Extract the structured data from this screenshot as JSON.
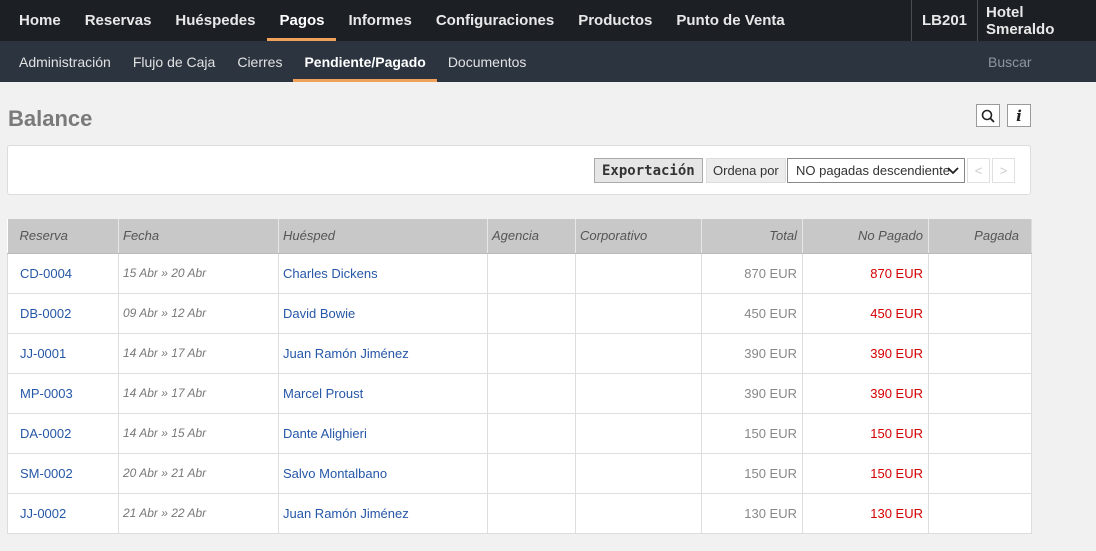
{
  "topnav": {
    "items": [
      "Home",
      "Reservas",
      "Huéspedes",
      "Pagos",
      "Informes",
      "Configuraciones",
      "Productos",
      "Punto de Venta"
    ],
    "active_index": 3,
    "code": "LB201",
    "hotel": "Hotel Smeraldo"
  },
  "subnav": {
    "items": [
      "Administración",
      "Flujo de Caja",
      "Cierres",
      "Pendiente/Pagado",
      "Documentos"
    ],
    "active_index": 3,
    "search": "Buscar"
  },
  "page": {
    "title": "Balance",
    "info_label": "i"
  },
  "toolbar": {
    "export_label": "Exportación",
    "sort_label": "Ordena por",
    "sort_value": "NO pagadas descendiente",
    "prev": "<",
    "next": ">"
  },
  "table": {
    "columns": [
      "Reserva",
      "Fecha",
      "Huésped",
      "Agencia",
      "Corporativo",
      "Total",
      "No Pagado",
      "Pagada"
    ],
    "rows": [
      {
        "reserva": "CD-0004",
        "fecha": "15 Abr » 20 Abr",
        "huesped": "Charles Dickens",
        "agencia": "",
        "corporativo": "",
        "total": "870 EUR",
        "no_pagado": "870 EUR",
        "pagada": ""
      },
      {
        "reserva": "DB-0002",
        "fecha": "09 Abr » 12 Abr",
        "huesped": "David Bowie",
        "agencia": "",
        "corporativo": "",
        "total": "450 EUR",
        "no_pagado": "450 EUR",
        "pagada": ""
      },
      {
        "reserva": "JJ-0001",
        "fecha": "14 Abr » 17 Abr",
        "huesped": "Juan Ramón Jiménez",
        "agencia": "",
        "corporativo": "",
        "total": "390 EUR",
        "no_pagado": "390 EUR",
        "pagada": ""
      },
      {
        "reserva": "MP-0003",
        "fecha": "14 Abr » 17 Abr",
        "huesped": "Marcel Proust",
        "agencia": "",
        "corporativo": "",
        "total": "390 EUR",
        "no_pagado": "390 EUR",
        "pagada": ""
      },
      {
        "reserva": "DA-0002",
        "fecha": "14 Abr » 15 Abr",
        "huesped": "Dante Alighieri",
        "agencia": "",
        "corporativo": "",
        "total": "150 EUR",
        "no_pagado": "150 EUR",
        "pagada": ""
      },
      {
        "reserva": "SM-0002",
        "fecha": "20 Abr » 21 Abr",
        "huesped": "Salvo Montalbano",
        "agencia": "",
        "corporativo": "",
        "total": "150 EUR",
        "no_pagado": "150 EUR",
        "pagada": ""
      },
      {
        "reserva": "JJ-0002",
        "fecha": "21 Abr » 22 Abr",
        "huesped": "Juan Ramón Jiménez",
        "agencia": "",
        "corporativo": "",
        "total": "130 EUR",
        "no_pagado": "130 EUR",
        "pagada": ""
      }
    ]
  },
  "colors": {
    "accent": "#f0a25a",
    "link": "#2557a7",
    "unpaid": "#d50000"
  }
}
